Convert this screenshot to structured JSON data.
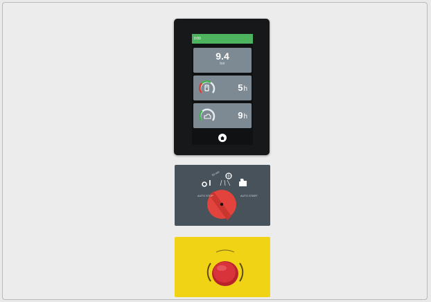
{
  "hmi": {
    "status_bar_text": "0:00",
    "pressure": {
      "value": "9.4",
      "unit": "bar"
    },
    "fuel": {
      "hours": "5",
      "unit": "h",
      "icon": "fuel-icon"
    },
    "service": {
      "hours": "9",
      "unit": "h",
      "icon": "engine-service-icon"
    },
    "home_icon": "home-icon",
    "colors": {
      "status_bar": "#4eb35e",
      "tile": "#7d8a93",
      "gauge_green": "#3fb24f",
      "gauge_red": "#d83a2f"
    }
  },
  "selector": {
    "labels": [
      "30 min",
      "AUTO STOP",
      "AUTO START"
    ],
    "icons": [
      "off-icon",
      "on-icon",
      "settings-icon",
      "engine-icon"
    ],
    "colors": {
      "knob": "#e2433c",
      "panel": "#47525a"
    }
  },
  "estop": {
    "colors": {
      "panel": "#f1d316",
      "button": "#d8333b"
    }
  }
}
